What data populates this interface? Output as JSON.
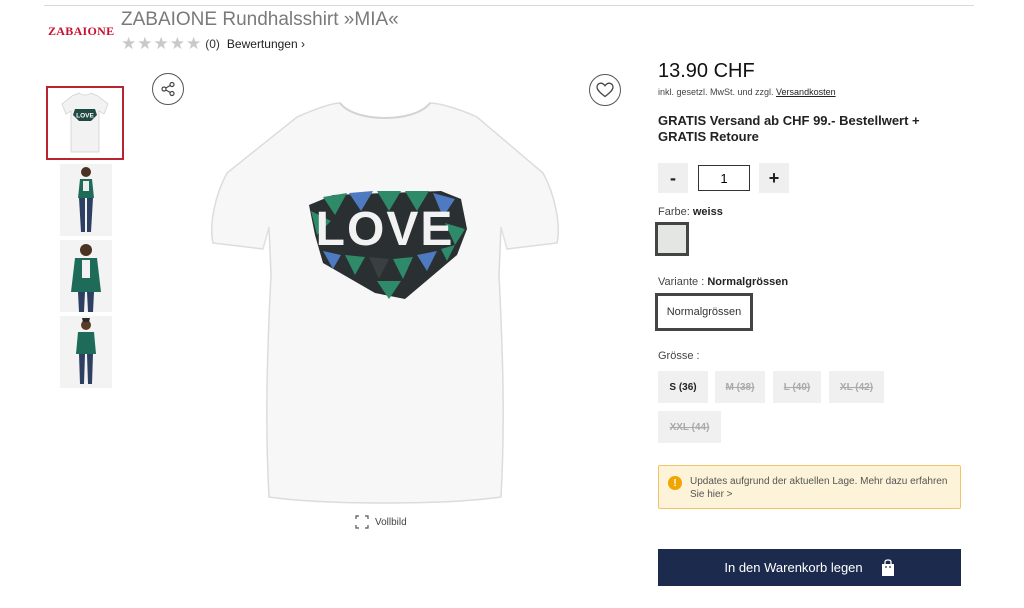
{
  "brand": {
    "logo_text": "ZABAIONE",
    "logo_icon": "brand-logo",
    "accent_color": "#c8102e"
  },
  "product": {
    "title": "ZABAIONE Rundhalsshirt »MIA«",
    "rating_stars": 0,
    "rating_count": "(0)",
    "reviews_label": "Bewertungen ›",
    "graphic_text": "LOVE"
  },
  "gallery": {
    "share_icon": "share-icon",
    "wishlist_icon": "heart-icon",
    "fullscreen_label": "Vollbild",
    "thumbnails": [
      "shirt-front",
      "model-full-1",
      "model-full-2",
      "model-full-3"
    ]
  },
  "pricing": {
    "price": "13.90 CHF",
    "tax_note": "inkl. gesetzl. MwSt. und zzgl. ",
    "shipping_link": "Versandkosten",
    "shipping_promo": "GRATIS Versand ab CHF 99.- Bestellwert + GRATIS Retoure"
  },
  "quantity": {
    "minus": "-",
    "value": "1",
    "plus": "+"
  },
  "color": {
    "label": "Farbe:",
    "value": "weiss",
    "swatch_color": "#e4e6e4"
  },
  "variant": {
    "label": "Variante :",
    "value": "Normalgrössen",
    "option": "Normalgrössen"
  },
  "size": {
    "label": "Grösse :",
    "options": [
      {
        "label": "S (36)",
        "available": true
      },
      {
        "label": "M (38)",
        "available": false
      },
      {
        "label": "L (40)",
        "available": false
      },
      {
        "label": "XL (42)",
        "available": false
      },
      {
        "label": "XXL (44)",
        "available": false
      }
    ]
  },
  "notice": {
    "icon": "warning-icon",
    "text": "Updates aufgrund der aktuellen Lage. Mehr dazu erfahren Sie hier >"
  },
  "cart": {
    "label": "In den Warenkorb legen",
    "icon": "shopping-bag-icon",
    "button_color": "#1c2a4e"
  }
}
